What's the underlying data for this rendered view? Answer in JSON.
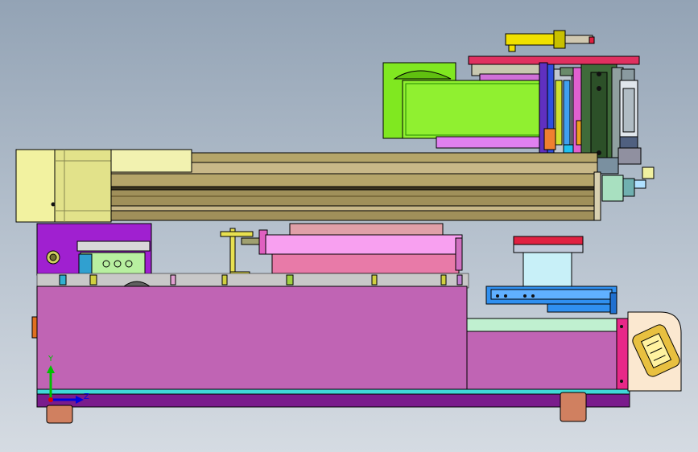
{
  "viewport": {
    "background": [
      "#93a3b5",
      "#d5dbe2"
    ],
    "edge_color": "#000000"
  },
  "triad": {
    "y_label": "Y",
    "z_label": "Z",
    "y_color": "#00c000",
    "z_color": "#0000e0",
    "origin_color": "#e00000"
  },
  "parts": [
    {
      "name": "motor-housing",
      "fill": "#f2f2a0"
    },
    {
      "name": "linear-rail",
      "fill": "#b5a56a"
    },
    {
      "name": "rail-lower-profile",
      "fill": "#a0905a"
    },
    {
      "name": "motor-mount-plate",
      "fill": "#a020d0"
    },
    {
      "name": "main-base-body",
      "fill": "#c064b4"
    },
    {
      "name": "base-bottom-plate",
      "fill": "#7a1c8c"
    },
    {
      "name": "cyan-base-strip",
      "fill": "#40d8d8"
    },
    {
      "name": "pink-slide-cylinder",
      "fill": "#f8a0f0"
    },
    {
      "name": "pink-slide-block",
      "fill": "#e87aa8"
    },
    {
      "name": "yellow-bracket",
      "fill": "#e8e050"
    },
    {
      "name": "green-module",
      "fill": "#80e820"
    },
    {
      "name": "top-cylinder",
      "fill": "#f0e000"
    },
    {
      "name": "red-top-plate",
      "fill": "#e03060"
    },
    {
      "name": "blue-guide-plate",
      "fill": "#3090f0"
    },
    {
      "name": "mint-support-plate",
      "fill": "#c0f0d0"
    },
    {
      "name": "cyan-column",
      "fill": "#c8f0f8"
    },
    {
      "name": "red-cap",
      "fill": "#e02040"
    },
    {
      "name": "pink-end-post",
      "fill": "#e82888"
    },
    {
      "name": "end-bracket",
      "fill": "#fbe8d0"
    },
    {
      "name": "copper-foot",
      "fill": "#d08060"
    },
    {
      "name": "green-terminal-block",
      "fill": "#b8f0a0"
    },
    {
      "name": "violet-panel",
      "fill": "#e080f0"
    }
  ]
}
